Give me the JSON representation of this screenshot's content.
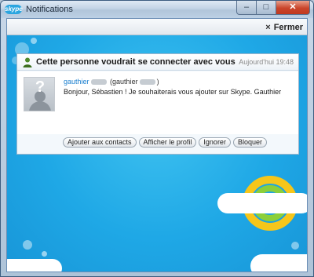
{
  "window": {
    "app_logo": "skype",
    "title": "Notifications",
    "controls": {
      "minimize": "–",
      "maximize": "□",
      "close": "✕"
    }
  },
  "toolbar": {
    "close_symbol": "×",
    "close_label": "Fermer"
  },
  "request": {
    "icon": "add-contact-icon",
    "title": "Cette personne voudrait se connecter avec vous",
    "time": "Aujourd'hui 19:48",
    "name_link": "gauthier",
    "name_paren_open": "(gauthier",
    "name_paren_close": ")",
    "message": "Bonjour, Sébastien ! Je souhaiterais vous ajouter sur Skype. Gauthier",
    "avatar_glyph": "?",
    "actions": [
      {
        "label": "Ajouter aux contacts"
      },
      {
        "label": "Afficher le profil"
      },
      {
        "label": "Ignorer"
      },
      {
        "label": "Bloquer"
      }
    ]
  },
  "colors": {
    "accent": "#1a7fcf",
    "background": "#1fa8e6",
    "close": "#c9452b"
  }
}
